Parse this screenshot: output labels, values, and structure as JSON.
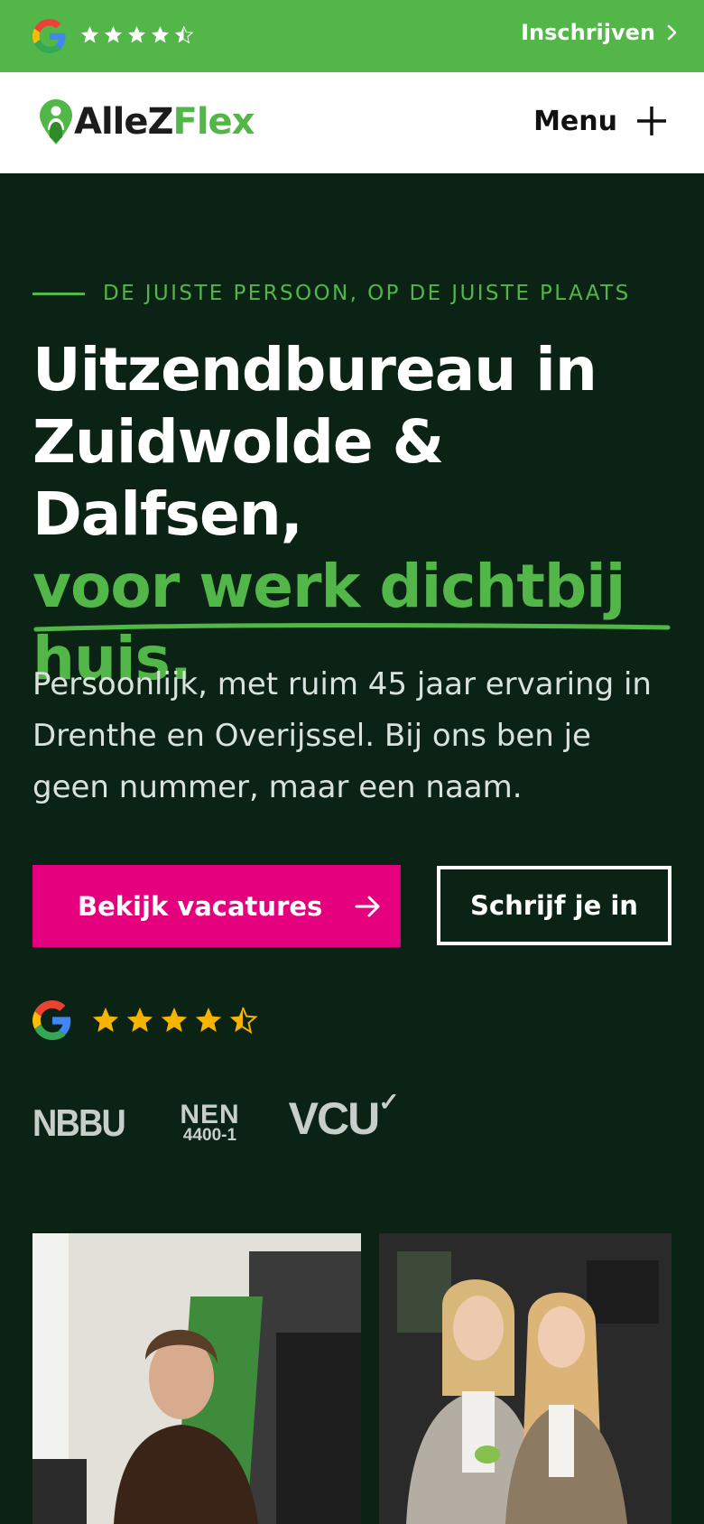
{
  "topbar": {
    "signup_label": "Inschrijven",
    "rating_stars": 4.5,
    "google_icon": "google-g-icon",
    "background": "#53b649"
  },
  "header": {
    "logo_part1": "AlleZ",
    "logo_part2": "Flex",
    "menu_label": "Menu"
  },
  "hero": {
    "eyebrow": "DE JUISTE PERSOON, OP DE JUISTE PLAATS",
    "title_line1": "Uitzendbureau in",
    "title_line2": "Zuidwolde & Dalfsen,",
    "title_line3": "voor werk dichtbij",
    "title_line4": "huis.",
    "lead": "Persoonlijk, met ruim 45 jaar ervaring in Drenthe en Overijssel. Bij ons ben je geen nummer, maar een naam.",
    "primary_button": "Bekijk vacatures",
    "secondary_button": "Schrijf je in",
    "rating_stars": 4.5
  },
  "certifications": {
    "nbbu": "NBBU",
    "nen_line1": "NEN",
    "nen_line2": "4400-1",
    "vcu": "VCU"
  },
  "colors": {
    "background": "#0a2314",
    "accent_green": "#53b649",
    "primary_button": "#e5007e",
    "star": "#f5b400"
  }
}
